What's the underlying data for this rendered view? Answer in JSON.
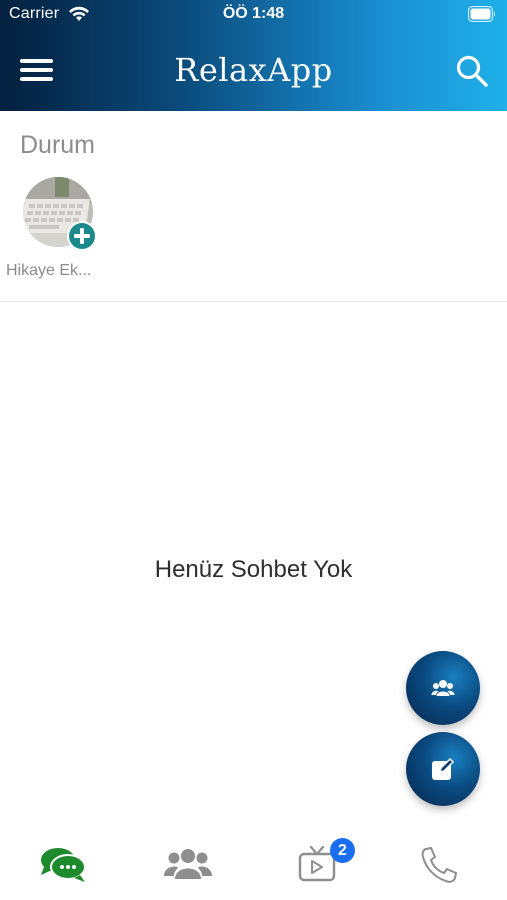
{
  "status_bar": {
    "carrier": "Carrier",
    "time": "ÖÖ 1:48"
  },
  "header": {
    "title": "RelaxApp",
    "menu_icon": "hamburger-menu-icon",
    "search_icon": "search-icon"
  },
  "status_section": {
    "title": "Durum",
    "story_label": "Hikaye Ek...",
    "add_icon": "plus-circle-icon"
  },
  "main": {
    "empty_message": "Henüz Sohbet Yok"
  },
  "fabs": [
    {
      "icon": "group-icon"
    },
    {
      "icon": "compose-icon"
    }
  ],
  "tab_bar": {
    "tabs": [
      {
        "icon": "chat-bubbles-icon",
        "active": true
      },
      {
        "icon": "users-icon",
        "active": false
      },
      {
        "icon": "tv-icon",
        "active": false,
        "badge": "2"
      },
      {
        "icon": "phone-icon",
        "active": false
      }
    ]
  },
  "colors": {
    "header_start": "#04203e",
    "header_end": "#1fb0ea",
    "accent_green": "#1e8a2e",
    "badge_blue": "#1a6ef0",
    "add_teal": "#1c8a8c"
  }
}
